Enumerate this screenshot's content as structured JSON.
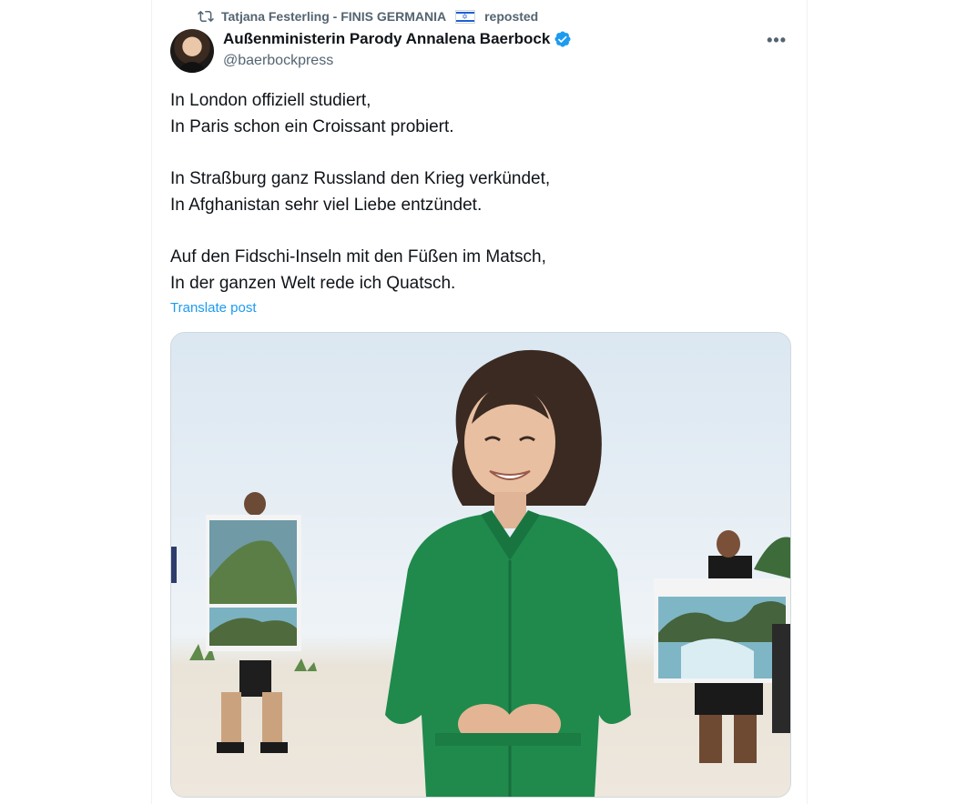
{
  "repost": {
    "reposter": "Tatjana Festerling - FINIS GERMANIA",
    "flag": "israel-flag",
    "suffix": "reposted"
  },
  "author": {
    "display_name": "Außenministerin Parody Annalena Baerbock",
    "handle": "@baerbockpress",
    "verified": true
  },
  "tweet": {
    "lines": [
      "In London offiziell studiert,",
      "In Paris schon ein Croissant probiert.",
      "In Straßburg ganz Russland den Krieg verkündet,",
      "In Afghanistan sehr viel Liebe entzündet.",
      "Auf den Fidschi-Inseln mit den Füßen im Matsch,",
      "In der ganzen Welt rede ich Quatsch."
    ],
    "translate_label": "Translate post"
  },
  "icons": {
    "repost": "repost-icon",
    "verified": "verified-badge-icon",
    "more": "more-icon"
  },
  "colors": {
    "accent": "#1d9bf0",
    "muted": "#536471",
    "dress": "#1f8a4c"
  }
}
